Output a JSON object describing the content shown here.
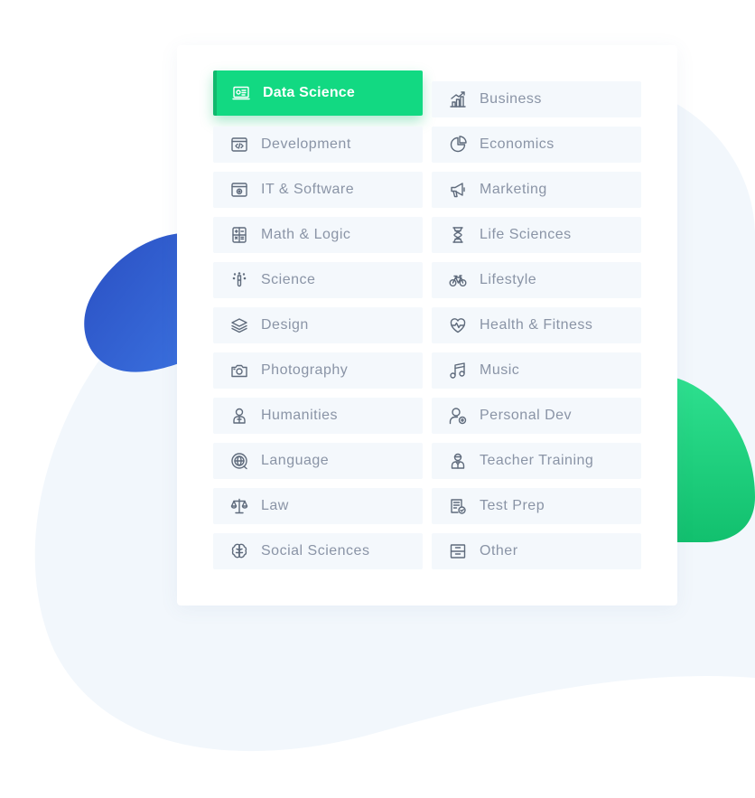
{
  "colors": {
    "accent_green": "#12d982",
    "blob_blue": "#2f5fd0",
    "blob_green": "#1fd17e",
    "backdrop_light": "#f2f7fc",
    "item_bg": "#f4f8fc",
    "label_text": "#8a94a6",
    "icon_stroke": "#5f6b7c"
  },
  "categories": {
    "selected": "Data Science",
    "left": [
      {
        "label": "Data Science",
        "icon": "data-science-icon",
        "active": true
      },
      {
        "label": "Development",
        "icon": "code-window-icon"
      },
      {
        "label": "IT & Software",
        "icon": "software-window-icon"
      },
      {
        "label": "Math & Logic",
        "icon": "calculator-icon"
      },
      {
        "label": "Science",
        "icon": "test-tube-icon"
      },
      {
        "label": "Design",
        "icon": "layers-icon"
      },
      {
        "label": "Photography",
        "icon": "camera-icon"
      },
      {
        "label": "Humanities",
        "icon": "person-icon"
      },
      {
        "label": "Language",
        "icon": "globe-chat-icon"
      },
      {
        "label": "Law",
        "icon": "scales-icon"
      },
      {
        "label": "Social Sciences",
        "icon": "brain-icon"
      }
    ],
    "right": [
      {
        "label": "Business",
        "icon": "growth-chart-icon"
      },
      {
        "label": "Economics",
        "icon": "pie-chart-icon"
      },
      {
        "label": "Marketing",
        "icon": "megaphone-icon"
      },
      {
        "label": "Life Sciences",
        "icon": "dna-icon"
      },
      {
        "label": "Lifestyle",
        "icon": "bicycle-icon"
      },
      {
        "label": "Health & Fitness",
        "icon": "heart-pulse-icon"
      },
      {
        "label": "Music",
        "icon": "music-note-icon"
      },
      {
        "label": "Personal Dev",
        "icon": "user-settings-icon"
      },
      {
        "label": "Teacher Training",
        "icon": "teacher-icon"
      },
      {
        "label": "Test Prep",
        "icon": "checklist-icon"
      },
      {
        "label": "Other",
        "icon": "archive-box-icon"
      }
    ]
  }
}
